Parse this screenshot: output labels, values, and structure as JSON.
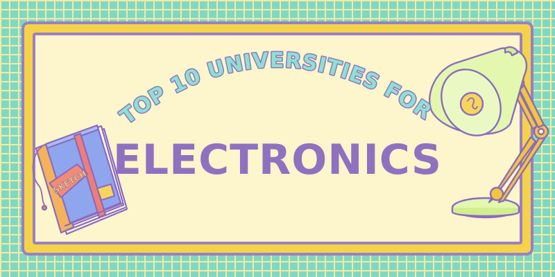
{
  "banner": {
    "subtitle": "TOP 10 UNIVERSITIES FOR",
    "title": "ELECTRONICS",
    "notebook_label": "SKETCH"
  },
  "colors": {
    "grid_background": "#7fd9c2",
    "grid_lines": "#f6e9a5",
    "frame_yellow": "#f4d24a",
    "frame_border": "#9b7fc3",
    "panel_cream": "#fdf5cc",
    "title_purple": "#8f71c0",
    "subtitle_mint": "#8ee0d3",
    "lamp_green": "#e3f7ae",
    "lamp_arm": "#f4c53a",
    "notebook_blue": "#8fa6ee",
    "notebook_label_red": "#f28a7a"
  },
  "icons": [
    "notebook-icon",
    "desk-lamp-icon"
  ]
}
